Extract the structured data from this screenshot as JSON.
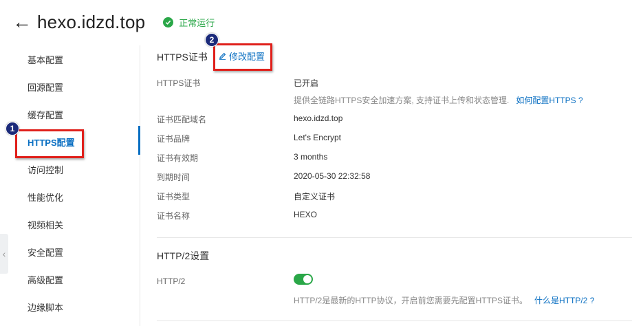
{
  "header": {
    "back_icon": "arrow-left-icon",
    "title": "hexo.idzd.top",
    "status_icon": "check-circle-icon",
    "status_text": "正常运行",
    "status_color": "#2aa748"
  },
  "sidebar": {
    "items": [
      {
        "label": "基本配置"
      },
      {
        "label": "回源配置"
      },
      {
        "label": "缓存配置"
      },
      {
        "label": "HTTPS配置",
        "active": true
      },
      {
        "label": "访问控制"
      },
      {
        "label": "性能优化"
      },
      {
        "label": "视频相关"
      },
      {
        "label": "安全配置"
      },
      {
        "label": "高级配置"
      },
      {
        "label": "边缘脚本"
      }
    ],
    "collapse_icon": "chevron-left-icon"
  },
  "annotations": {
    "marker1": "1",
    "marker2": "2",
    "highlight_color": "#e0201b"
  },
  "https_section": {
    "title": "HTTPS证书",
    "edit_icon": "pencil-icon",
    "edit_label": "修改配置",
    "rows": [
      {
        "label": "HTTPS证书",
        "value": "已开启"
      },
      {
        "label": "证书匹配域名",
        "value": "hexo.idzd.top"
      },
      {
        "label": "证书品牌",
        "value": "Let's Encrypt"
      },
      {
        "label": "证书有效期",
        "value": "3 months"
      },
      {
        "label": "到期时间",
        "value": "2020-05-30 22:32:58"
      },
      {
        "label": "证书类型",
        "value": "自定义证书"
      },
      {
        "label": "证书名称",
        "value": "HEXO"
      }
    ],
    "desc": "提供全链路HTTPS安全加速方案, 支持证书上传和状态管理.",
    "desc_link": "如何配置HTTPS ?"
  },
  "http2_section": {
    "title": "HTTP/2设置",
    "label": "HTTP/2",
    "enabled": true,
    "desc": "HTTP/2是最新的HTTP协议，开启前您需要先配置HTTPS证书。",
    "desc_link": "什么是HTTP/2 ?"
  },
  "colors": {
    "accent": "#0a6fc2",
    "success": "#2aa748"
  }
}
